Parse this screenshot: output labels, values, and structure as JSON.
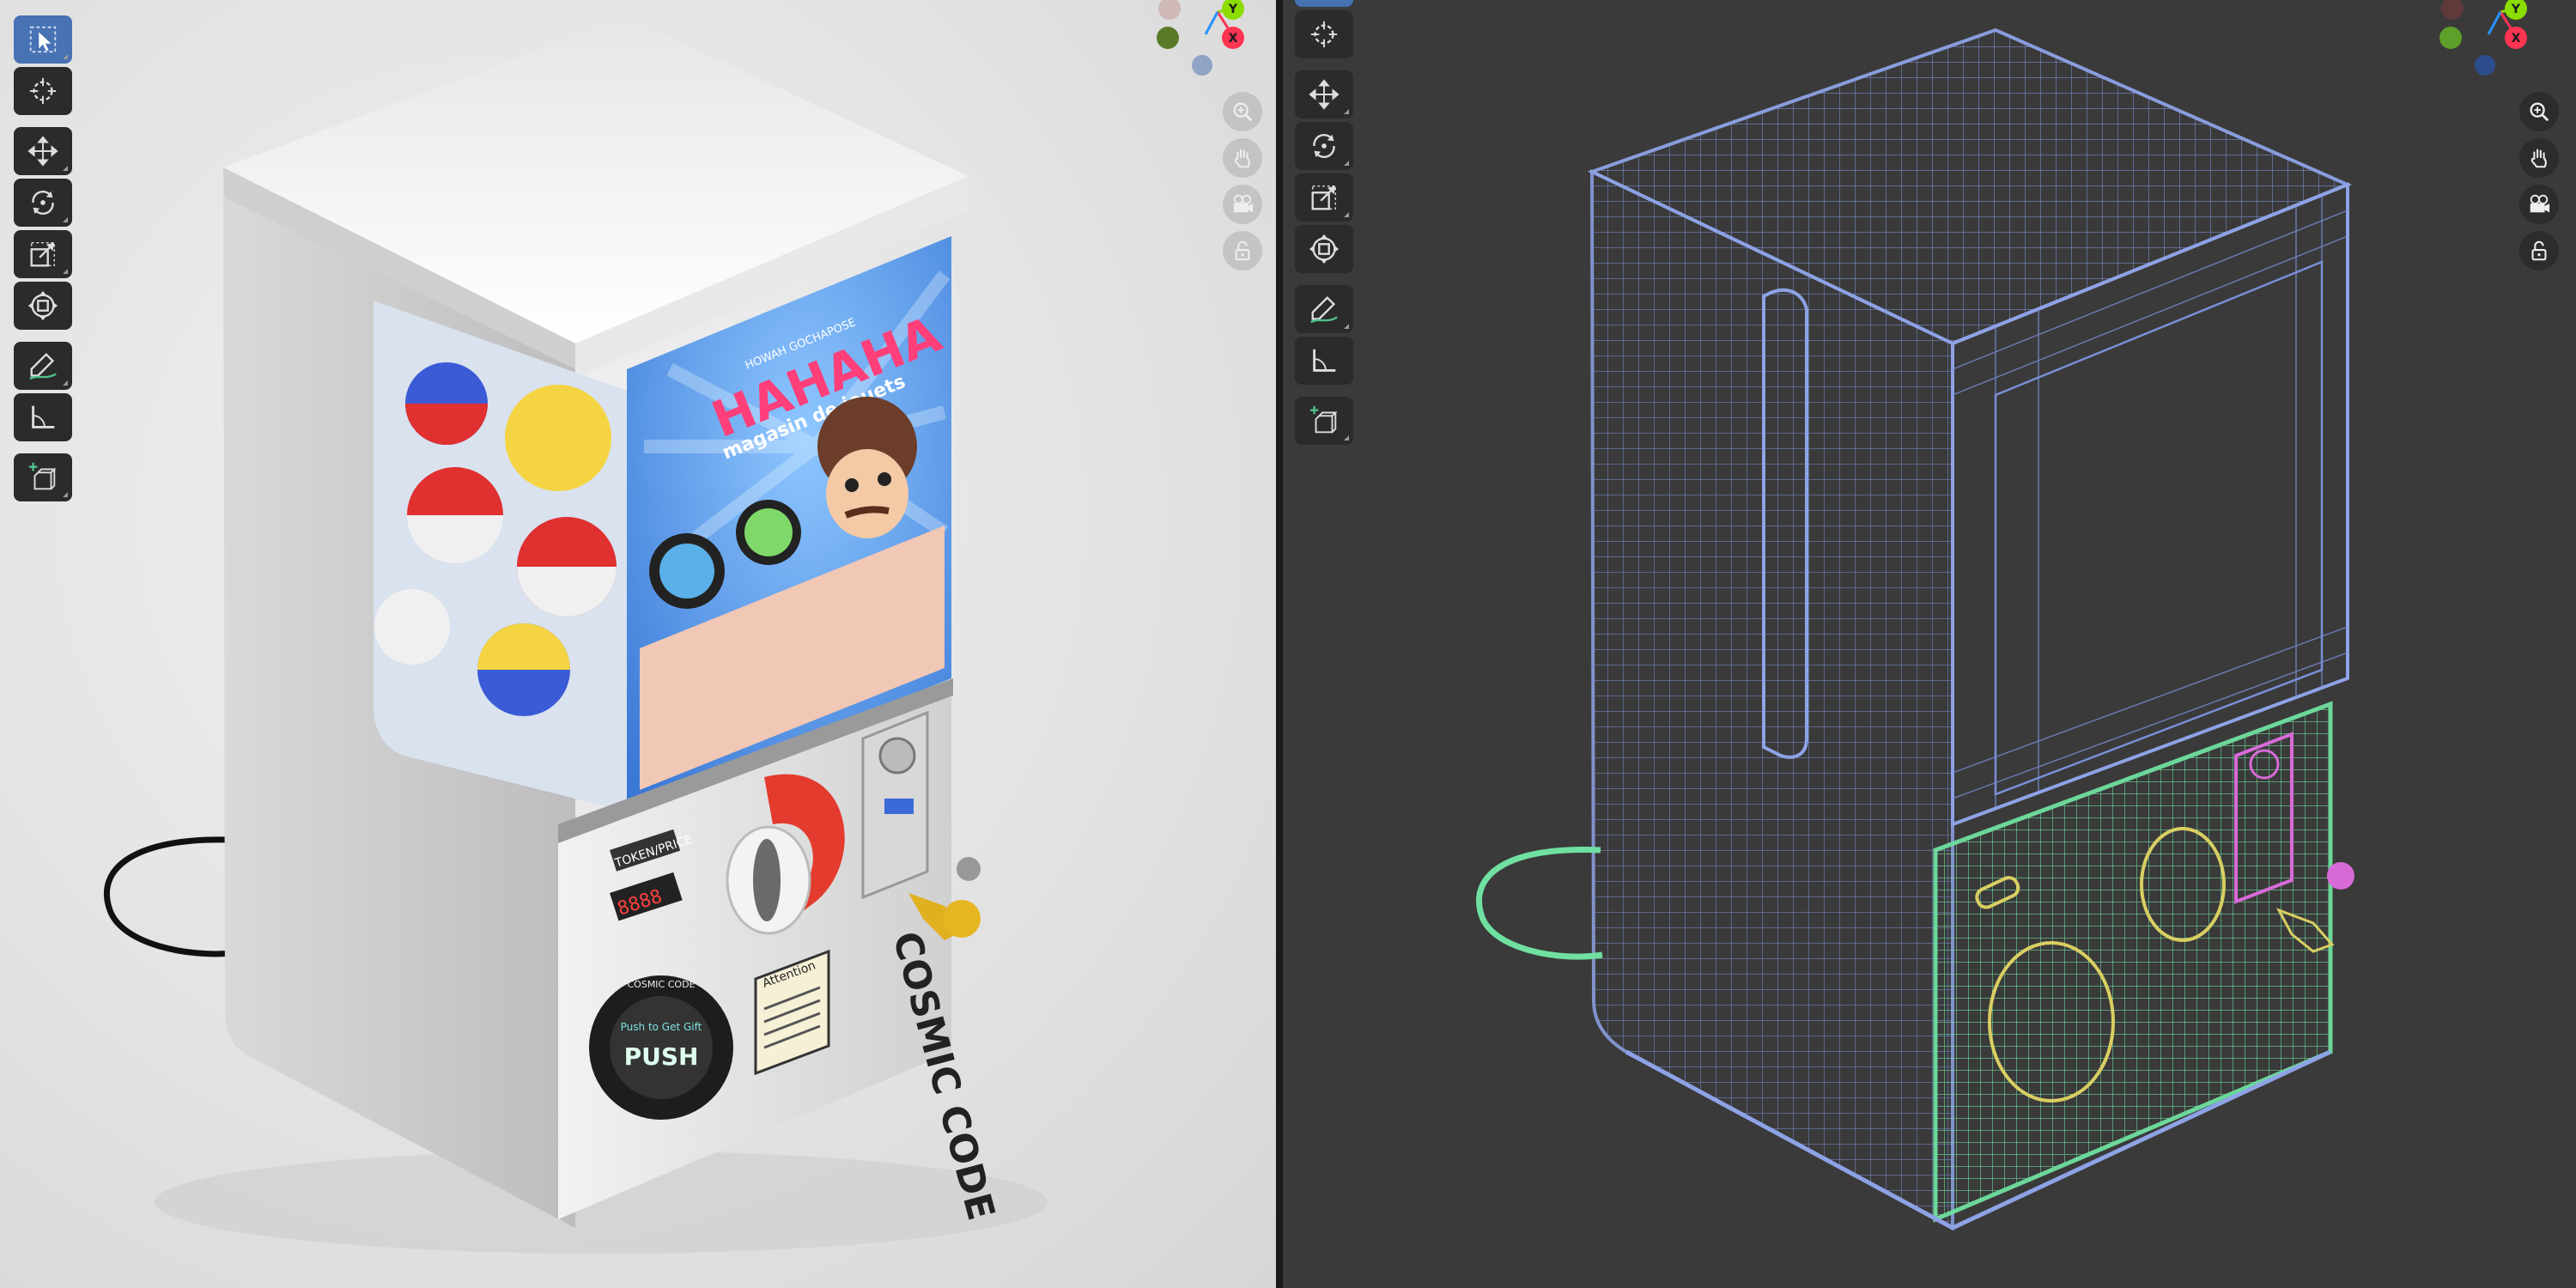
{
  "left_viewport": {
    "mode": "material-preview",
    "tools": [
      "select-box",
      "cursor",
      "move",
      "rotate",
      "scale",
      "transform",
      "annotate",
      "measure",
      "add-cube"
    ],
    "nav": [
      "zoom-icon",
      "hand-pan-icon",
      "camera-icon",
      "lock-icon"
    ],
    "gizmo_axes": {
      "y": "Y",
      "x": "X"
    },
    "machine": {
      "brand_line": "HOWAH GOCHAPOSE",
      "logo": "HAHAHA",
      "tagline": "magasin de jouets",
      "token_label": "TOKEN/PRICE",
      "token_display": "8888",
      "push_top": "Push to Get Gift",
      "push_label": "PUSH",
      "ring_text": "COSMIC CODE",
      "attention_title": "Attention",
      "side_title": "COSMIC CODE"
    }
  },
  "right_viewport": {
    "mode": "wireframe",
    "tools": [
      "cursor",
      "move",
      "rotate",
      "scale",
      "transform",
      "annotate",
      "measure",
      "add-cube"
    ],
    "nav": [
      "zoom-icon",
      "hand-pan-icon",
      "camera-icon",
      "lock-icon"
    ],
    "gizmo_axes": {
      "y": "Y",
      "x": "X"
    }
  },
  "colors": {
    "active_tool": "#4772b3",
    "tool_bg": "#2b2b2b",
    "axis_x": "#ff3352",
    "axis_y": "#8bdc00",
    "axis_z": "#2890ff",
    "wire_blue": "#7a8fd6",
    "wire_green": "#6fe0a0",
    "wire_yellow": "#d9cf62",
    "wire_magenta": "#d86ad8"
  }
}
